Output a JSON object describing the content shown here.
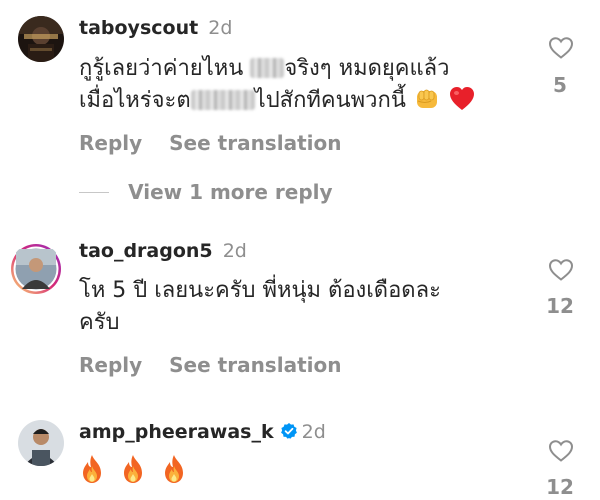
{
  "comments": [
    {
      "username": "taboyscout",
      "time": "2d",
      "line1_a": "กูรู้เลยว่าค่ายไหน",
      "line1_b": "จริงๆ หมดยุคแล้ว",
      "line2_a": "เมื่อไหร่จะต",
      "line2_b": "ไปสักทีคนพวกนี้",
      "emoji_1": "fist-emoji",
      "emoji_2": "red-heart-emoji",
      "reply_label": "Reply",
      "translation_label": "See translation",
      "likes": "5"
    },
    {
      "username": "tao_dragon5",
      "time": "2d",
      "line1": "โห 5 ปี เลยนะครับ พี่หนุ่ม ต้องเดือดละ",
      "line2": "ครับ",
      "reply_label": "Reply",
      "translation_label": "See translation",
      "likes": "12"
    },
    {
      "username": "amp_pheerawas_k",
      "time": "2d",
      "verified": true,
      "emojis": [
        "fire-emoji",
        "fire-emoji",
        "fire-emoji"
      ],
      "likes": "12"
    }
  ],
  "view_more_replies": "View 1 more reply",
  "icons": {
    "like": "heart-outline-icon",
    "verified": "verified-badge-icon"
  },
  "colors": {
    "text": "#262626",
    "secondary": "#8e8e8e",
    "verified": "#0095f6",
    "heart": "#e8202a",
    "fire": "#f7931e"
  }
}
